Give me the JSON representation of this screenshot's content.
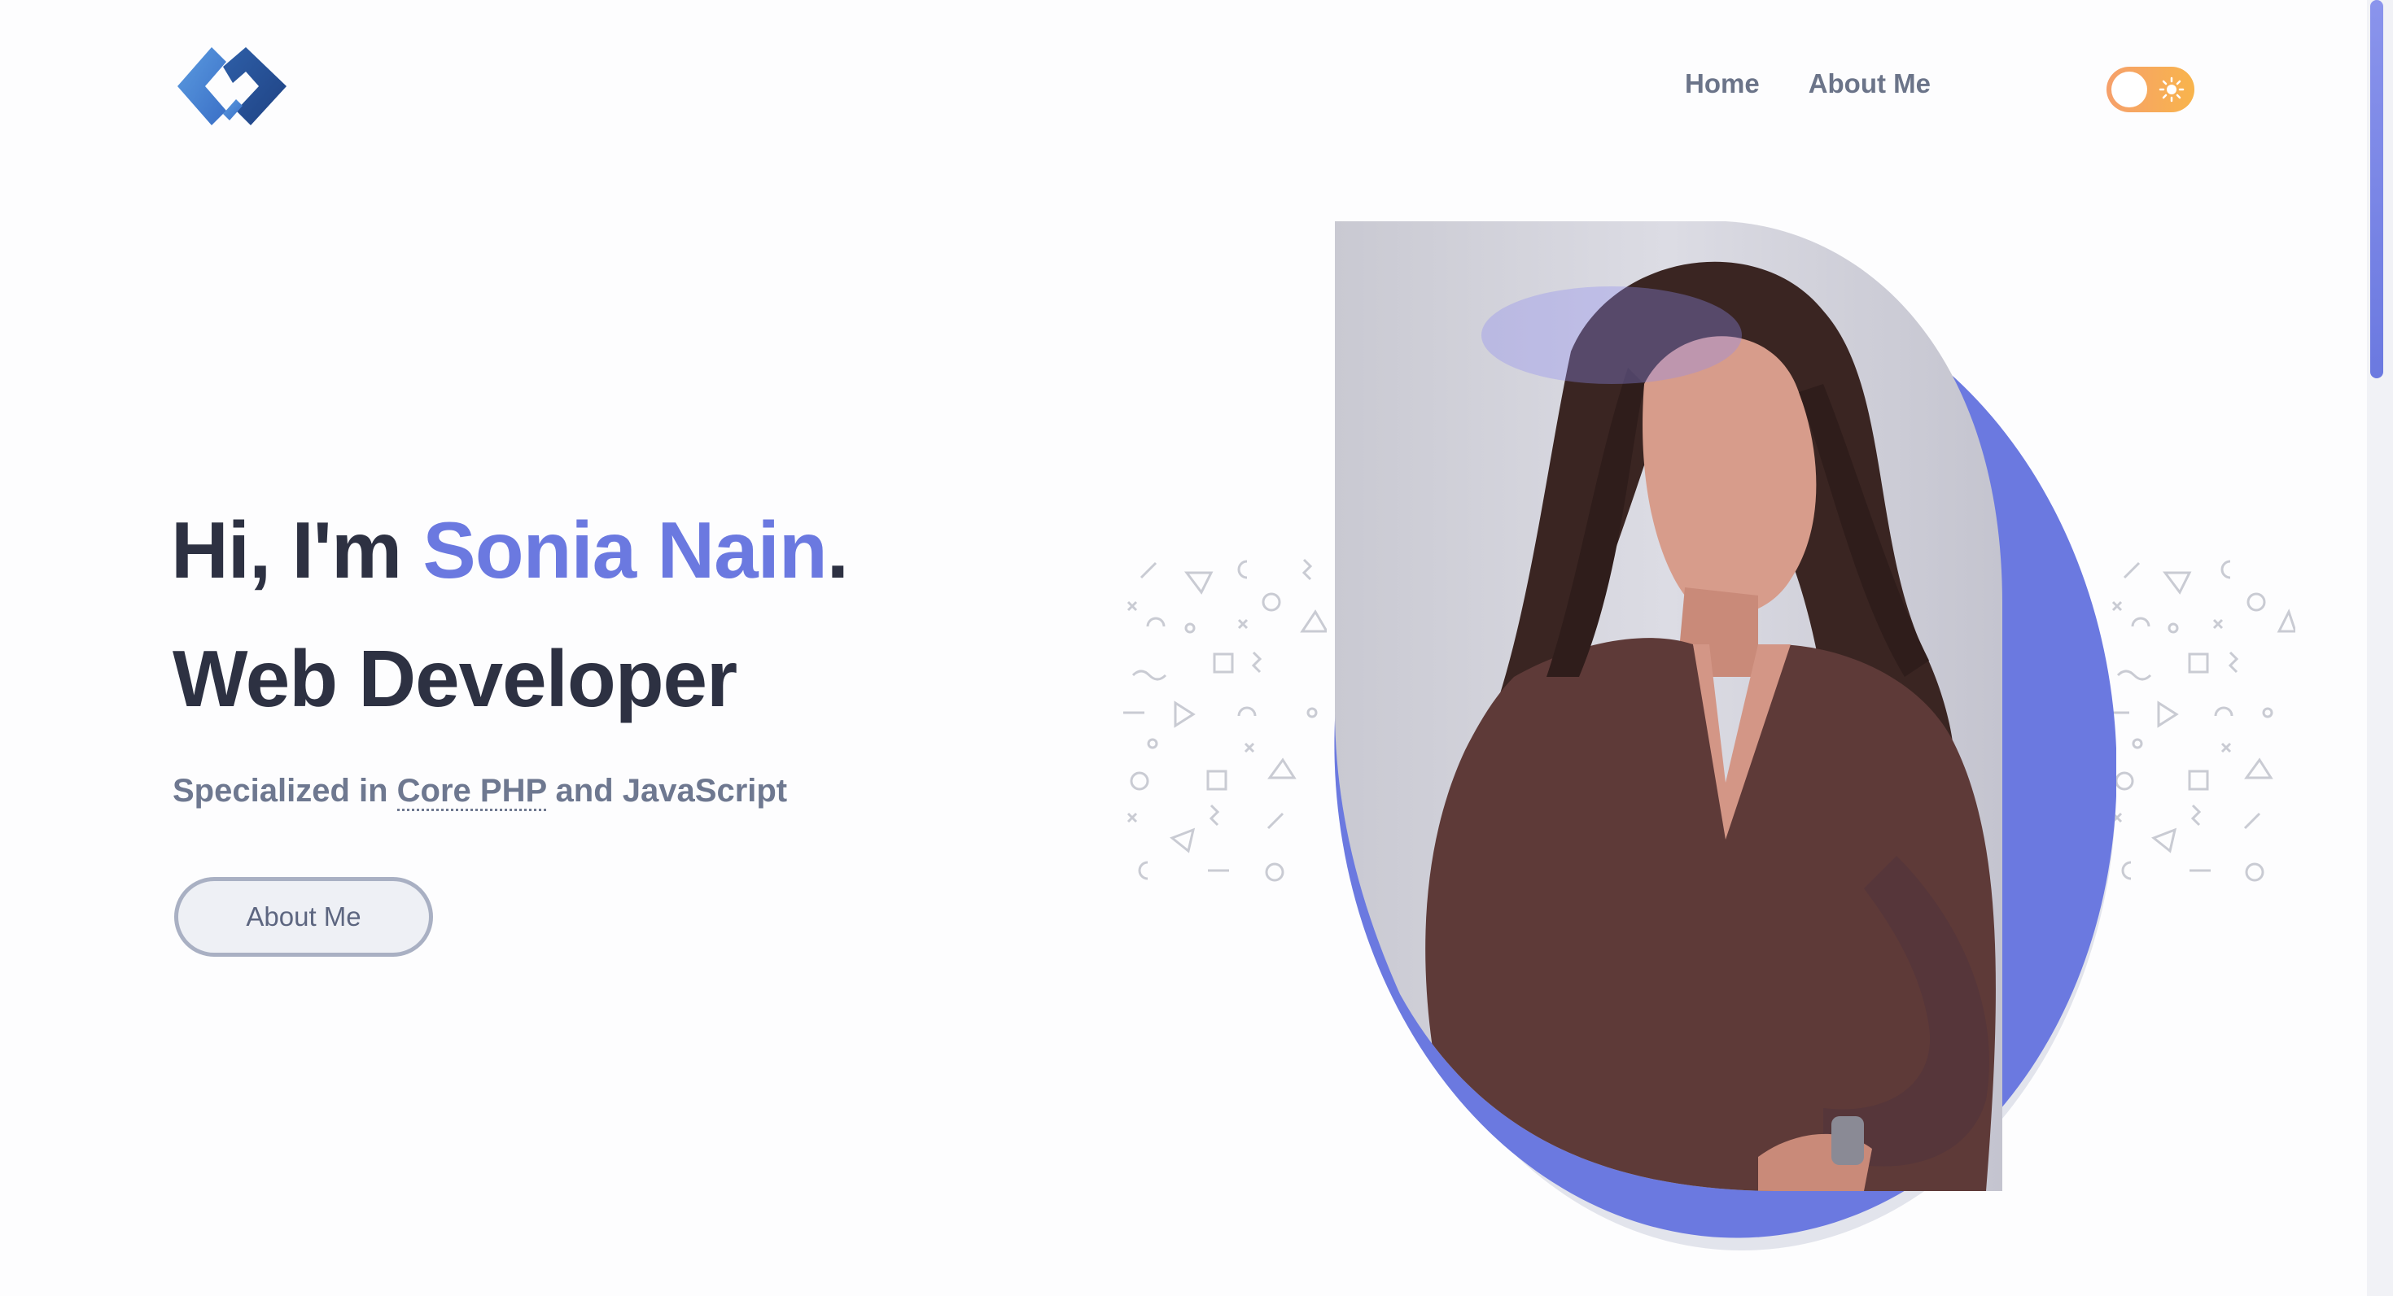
{
  "header": {
    "logo_icon": "diamond-chain-logo",
    "nav": [
      {
        "label": "Home"
      },
      {
        "label": "About Me"
      }
    ],
    "theme_toggle": {
      "icon": "sun-icon",
      "state": "light"
    }
  },
  "hero": {
    "greeting": "Hi, I'm ",
    "name": "Sonia Nain",
    "period": ".",
    "role": "Web Developer",
    "subtitle_prefix": "Specialized in ",
    "subtitle_tech1": "Core PHP",
    "subtitle_mid": " and ",
    "subtitle_tech2": "JavaScript",
    "cta_label": "About Me"
  },
  "colors": {
    "accent": "#6b79e0",
    "heading": "#2d3142",
    "muted": "#6e7890",
    "toggle": "#f8a55b"
  }
}
